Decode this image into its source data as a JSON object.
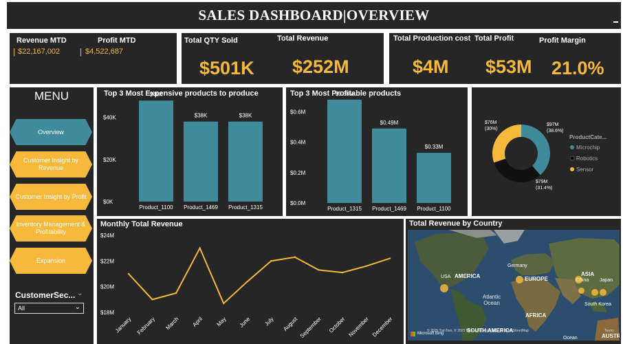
{
  "header": {
    "title": "SALES DASHBOARD|OVERVIEW"
  },
  "kpi1": {
    "revenue_mtd_label": "Revenue MTD",
    "revenue_mtd_value": "$22,167,002",
    "profit_mtd_label": "Profit MTD",
    "profit_mtd_value": "$4,522,687"
  },
  "kpi2": {
    "qty_label": "Total QTY Sold",
    "qty_value": "$501K",
    "revenue_label": "Total Revenue",
    "revenue_value": "$252M"
  },
  "kpi3": {
    "cost_label": "Total Production cost",
    "cost_value": "$4M",
    "profit_label": "Total Profit",
    "profit_value": "$53M",
    "margin_label": "Profit Margin",
    "margin_value": "21.0%"
  },
  "menu": {
    "title": "MENU",
    "items": [
      {
        "label": "Overview",
        "active": true
      },
      {
        "label": "Customer Insight by Revenue",
        "active": false
      },
      {
        "label": "Customer Insight by Profit",
        "active": false
      },
      {
        "label": "Inventory Management & Profitability",
        "active": false
      },
      {
        "label": "Expansion",
        "active": false
      }
    ],
    "slicer_label": "CustomerSec...",
    "slicer_value": "All"
  },
  "colors": {
    "accent": "#f6b93b",
    "teal": "#3f8b9b",
    "panel": "#262626",
    "black": "#111111"
  },
  "chart_data": [
    {
      "type": "bar",
      "title": "Top 3 Most Expensive products to produce",
      "categories": [
        "Product_1100",
        "Product_1469",
        "Product_1315"
      ],
      "values": [
        48000,
        38000,
        38000
      ],
      "data_labels": [
        "$48K",
        "$38K",
        "$38K"
      ],
      "yticks": [
        "$0K",
        "$20K",
        "$40K"
      ],
      "ylim": [
        0,
        50000
      ]
    },
    {
      "type": "bar",
      "title": "Top 3 Most Profitable products",
      "categories": [
        "Product_1315",
        "Product_1469",
        "Product_1100"
      ],
      "values": [
        0.68,
        0.49,
        0.33
      ],
      "data_labels": [
        "$0.68M",
        "$0.49M",
        "$0.33M"
      ],
      "yticks": [
        "$0.0M",
        "$0.2M",
        "$0.4M",
        "$0.6M"
      ],
      "ylim": [
        0,
        0.72
      ]
    },
    {
      "type": "pie",
      "title": "",
      "legend_title": "ProductCate...",
      "slices": [
        {
          "name": "Microchip",
          "value": 97,
          "label": "$97M",
          "pct": "(38.6%)",
          "color": "#3f8b9b"
        },
        {
          "name": "Robotics",
          "value": 79,
          "label": "$79M",
          "pct": "(31.4%)",
          "color": "#111111"
        },
        {
          "name": "Sensor",
          "value": 76,
          "label": "$76M",
          "pct": "(30%)",
          "color": "#f6b93b"
        }
      ]
    },
    {
      "type": "line",
      "title": "Monthly Total Revenue",
      "categories": [
        "January",
        "February",
        "March",
        "April",
        "May",
        "June",
        "July",
        "August",
        "September",
        "October",
        "November",
        "December"
      ],
      "values": [
        21.0,
        19.0,
        19.5,
        23.0,
        18.7,
        20.4,
        22.0,
        22.3,
        21.3,
        21.1,
        21.6,
        22.2
      ],
      "yticks": [
        "$18M",
        "$20M",
        "$22M",
        "$24M"
      ],
      "ylim": [
        18,
        24
      ]
    }
  ],
  "map": {
    "title": "Total Revenue by Country",
    "labels": {
      "usa": "USA",
      "america": "AMERICA",
      "germany": "Germany",
      "europe": "EUROPE",
      "asia": "ASIA",
      "china": "China",
      "japan": "Japan",
      "south_korea": "South Korea",
      "africa": "AFRICA",
      "atlantic": "Atlantic Ocean",
      "south_america": "SOUTH AMERICA",
      "austr": "AUSTR",
      "ocean": "Ocean",
      "bing": "Microsoft Bing",
      "copyright": "© 2025 TomTom, © 2025 Microsoft Corporation, © OpenStreetMap",
      "terms": "Terms"
    }
  }
}
